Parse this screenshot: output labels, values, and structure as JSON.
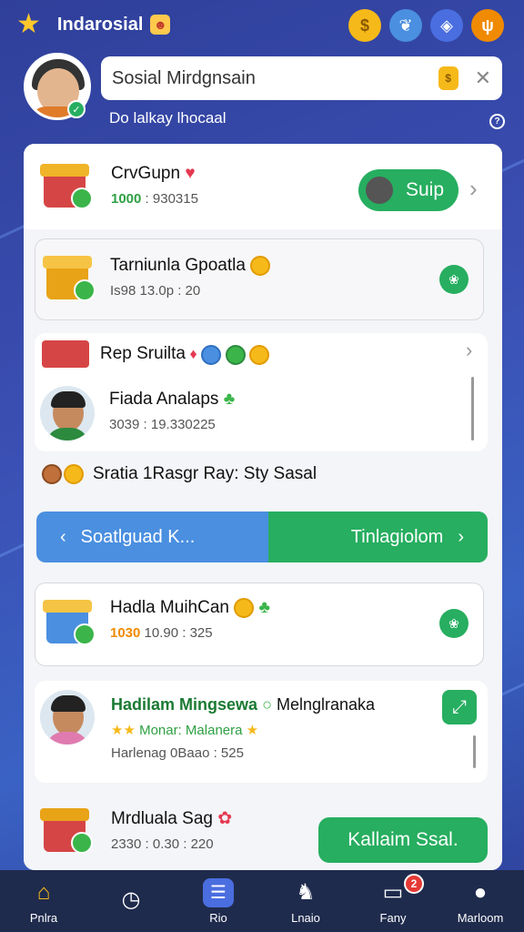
{
  "header": {
    "title": "Indarosial",
    "icons": [
      "star-icon",
      "badge-icon",
      "coin-icon",
      "leaf-icon",
      "shield-icon",
      "fire-icon"
    ]
  },
  "profile": {
    "search_value": "Sosial Mirdgnsain",
    "subtitle": "Do lalkay lhocaal"
  },
  "rows": {
    "r1": {
      "title": "CrvGupn",
      "amount": "1000",
      "sub_rest": ": 930315",
      "button": "Suip"
    },
    "r2": {
      "title": "Tarniunla Gpoatla",
      "sub": "Is98 13.0p : 20"
    },
    "r3": {
      "title": "Rep Sruilta",
      "person_title": "Fiada Analaps",
      "person_sub": "3039 : 19.330225"
    },
    "r4": {
      "title": "Sratia 1Rasgr Ray: Sty Sasal"
    },
    "nav": {
      "left": "Soatlguad K...",
      "right": "Tinlagiolom"
    },
    "r5": {
      "title": "Hadla MuihCan",
      "amount": "1030",
      "sub_rest": "10.90 : 325"
    },
    "r6": {
      "title_green": "Hadilam Mingsewa",
      "title_rest": "Melnglranaka",
      "sub1": "Monar: Malanera",
      "sub2": "Harlenag 0Baao : 525"
    },
    "r7": {
      "title": "Mrdluala Sag",
      "sub": "2330 : 0.30 : 220",
      "button": "Kallaim Ssal."
    }
  },
  "bottom_nav": [
    {
      "label": "Pnlra",
      "icon": "home-icon"
    },
    {
      "label": "",
      "icon": "clock-icon"
    },
    {
      "label": "Rio",
      "icon": "list-icon"
    },
    {
      "label": "Lnaio",
      "icon": "cat-icon"
    },
    {
      "label": "Fany",
      "icon": "chat-icon",
      "badge": "2"
    },
    {
      "label": "Marloom",
      "icon": "user-icon"
    }
  ],
  "colors": {
    "accent_green": "#27ae60",
    "accent_blue": "#4a8fe0",
    "nav_bg": "#1f2b4d"
  }
}
